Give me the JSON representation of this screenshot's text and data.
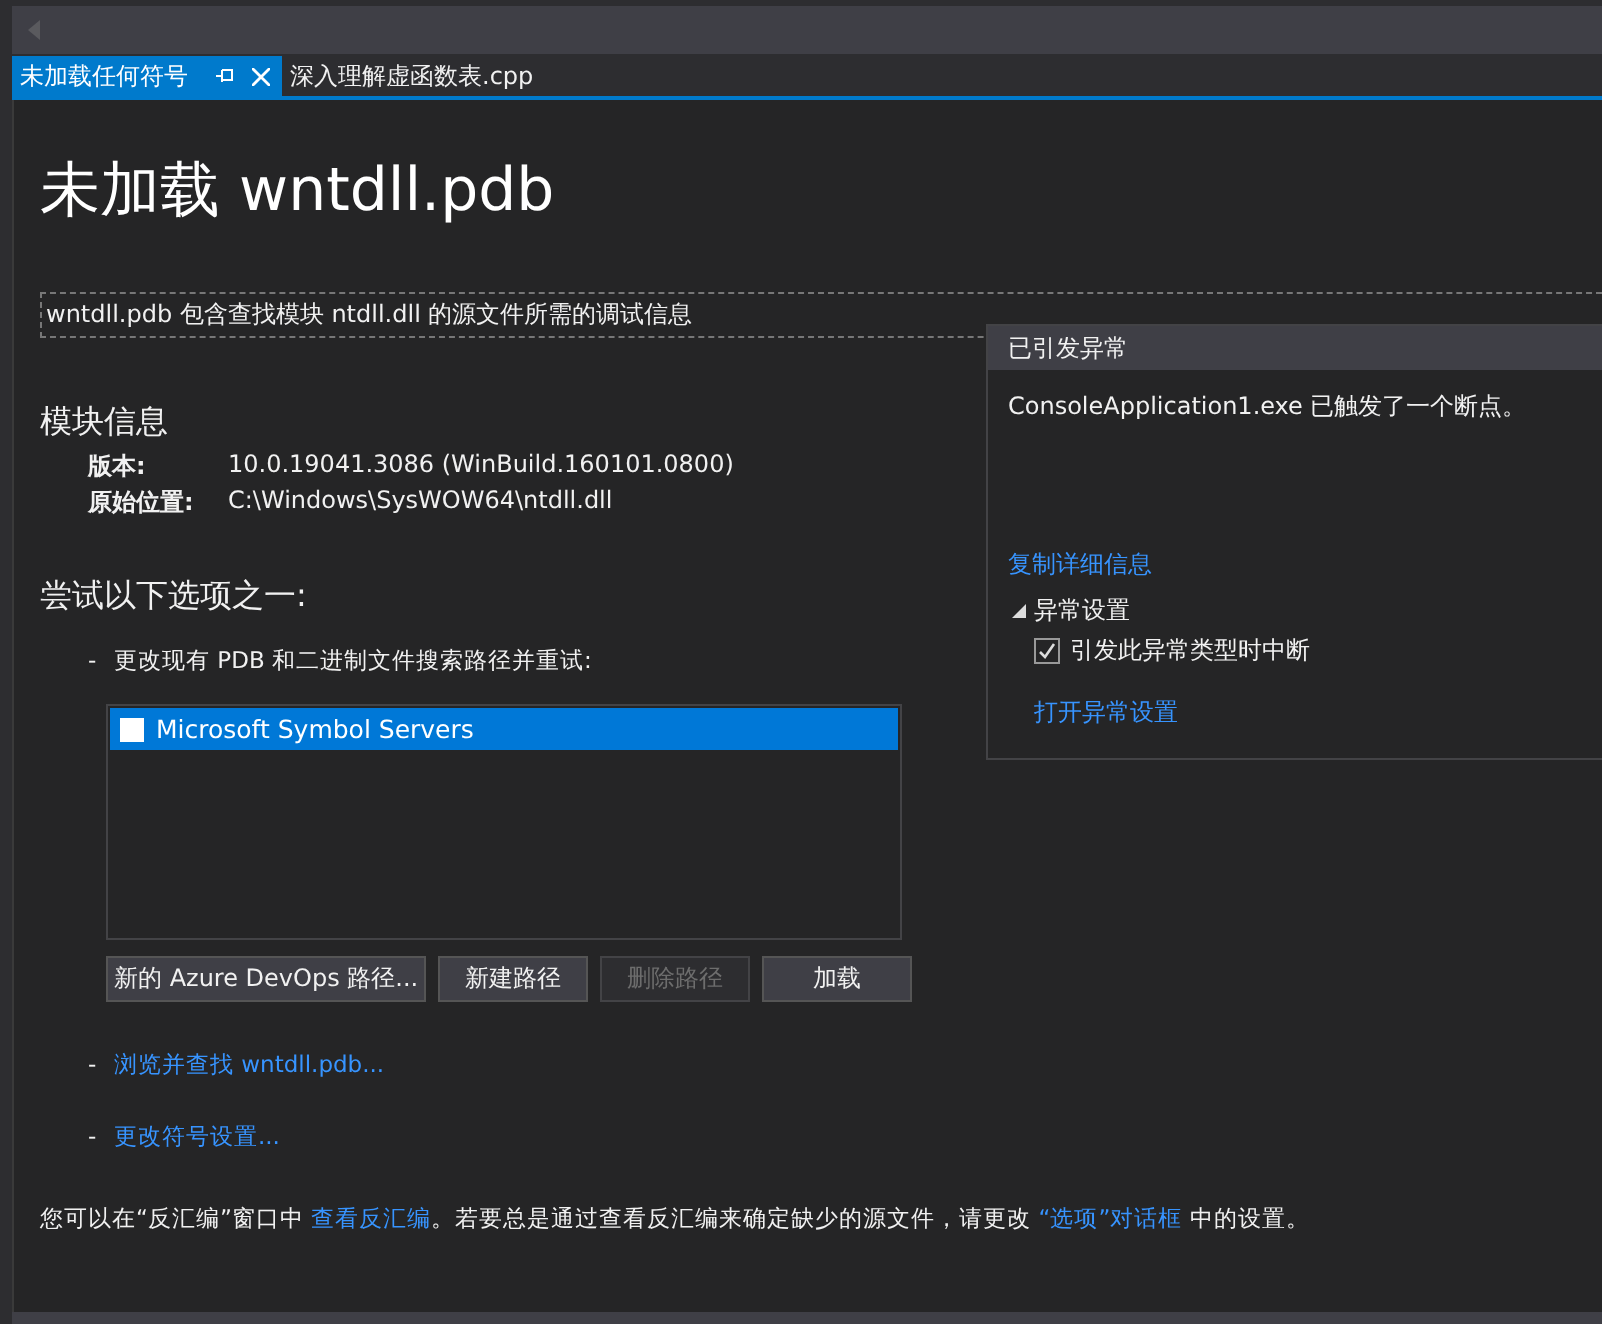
{
  "tabs": [
    {
      "label": "未加载任何符号",
      "selected": true
    },
    {
      "label": "深入理解虚函数表.cpp",
      "selected": false
    }
  ],
  "page": {
    "title": "未加载 wntdll.pdb",
    "description": "wntdll.pdb 包含查找模块 ntdll.dll 的源文件所需的调试信息",
    "module_info": {
      "heading": "模块信息",
      "fields": [
        {
          "label": "版本:",
          "value": "10.0.19041.3086 (WinBuild.160101.0800)"
        },
        {
          "label": "原始位置:",
          "value": "C:\\Windows\\SysWOW64\\ntdll.dll"
        }
      ]
    },
    "options": {
      "heading": "尝试以下选项之一:",
      "items": [
        {
          "kind": "paths",
          "bullet": "-",
          "text": "更改现有 PDB 和二进制文件搜索路径并重试:",
          "paths": [
            {
              "label": "Microsoft Symbol Servers",
              "checked": false,
              "selected": true
            }
          ],
          "buttons": [
            {
              "label": "新的 Azure DevOps 路径...",
              "disabled": false
            },
            {
              "label": "新建路径",
              "disabled": false
            },
            {
              "label": "删除路径",
              "disabled": true
            },
            {
              "label": "加载",
              "disabled": false
            }
          ]
        },
        {
          "kind": "link",
          "bullet": "-",
          "text": "浏览并查找 wntdll.pdb..."
        },
        {
          "kind": "link",
          "bullet": "-",
          "text": "更改符号设置..."
        }
      ]
    },
    "footer": [
      {
        "text": "您可以在“反汇编”窗口中 ",
        "link": false
      },
      {
        "text": "查看反汇编",
        "link": true
      },
      {
        "text": "。若要总是通过查看反汇编来确定缺少的源文件，请更改 ",
        "link": false
      },
      {
        "text": "“选项”对话框",
        "link": true
      },
      {
        "text": " 中的设置。",
        "link": false
      }
    ]
  },
  "exception_popup": {
    "title": "已引发异常",
    "message": "ConsoleApplication1.exe 已触发了一个断点。",
    "copy_link": "复制详细信息",
    "settings": {
      "label": "异常设置",
      "expanded": true,
      "option": {
        "label": "引发此异常类型时中断",
        "checked": true
      }
    },
    "open_link": "打开异常设置"
  }
}
